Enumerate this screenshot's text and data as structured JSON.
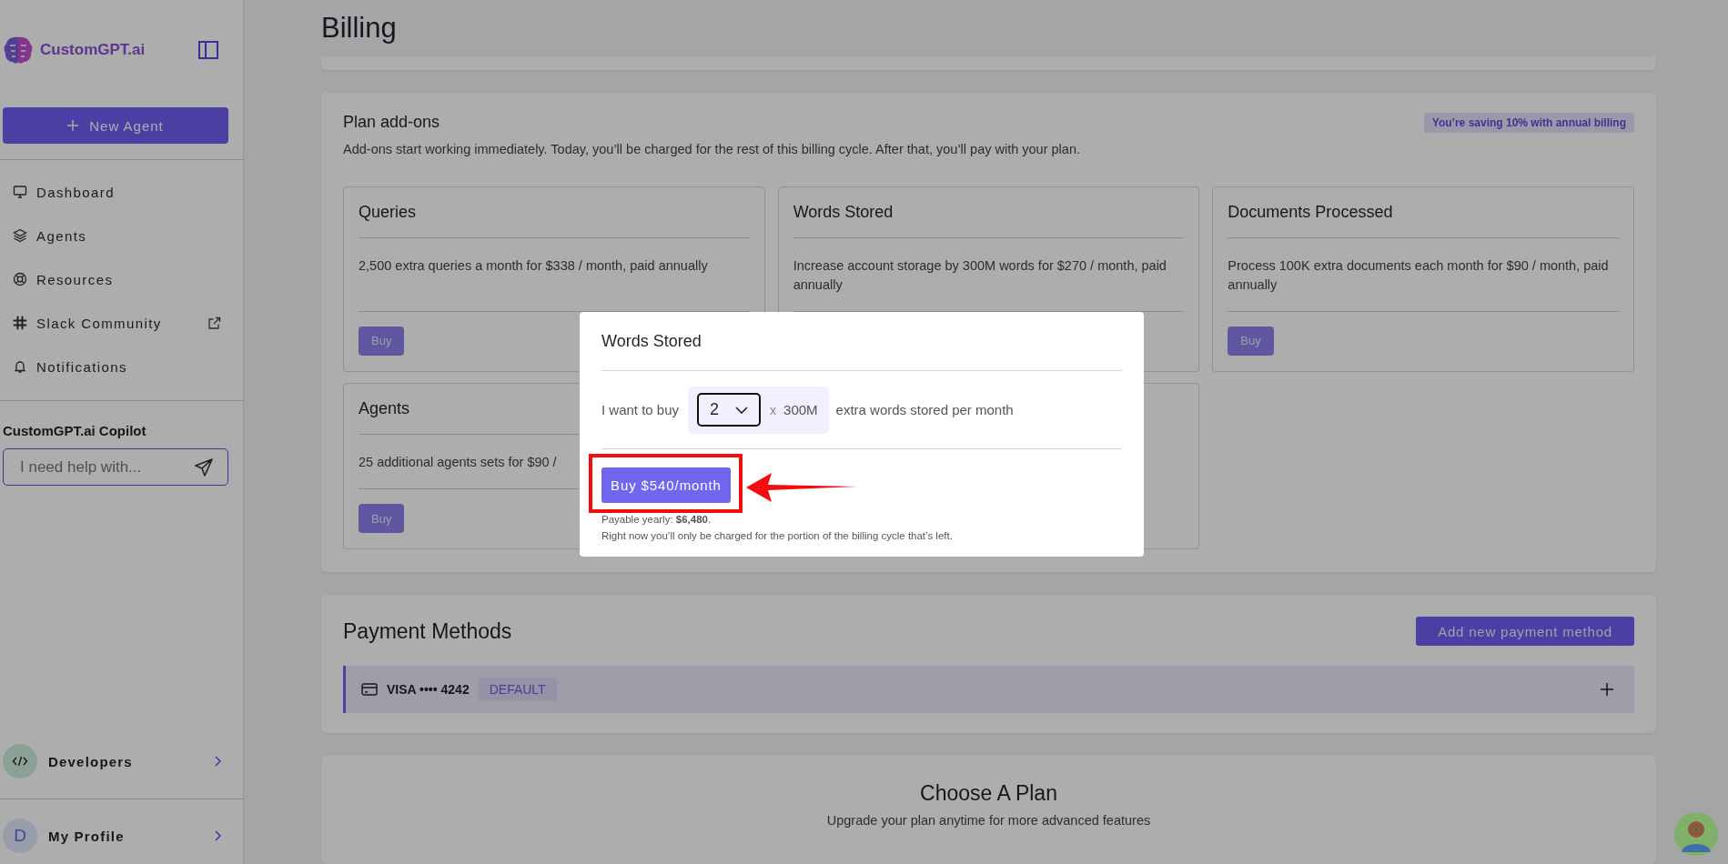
{
  "sidebar": {
    "logo_text": "CustomGPT.ai",
    "new_agent_button": "New Agent",
    "nav_items": [
      {
        "label": "Dashboard",
        "external": false
      },
      {
        "label": "Agents",
        "external": false
      },
      {
        "label": "Resources",
        "external": false
      },
      {
        "label": "Slack Community",
        "external": true
      },
      {
        "label": "Notifications",
        "external": false
      }
    ],
    "copilot": {
      "title": "CustomGPT.ai Copilot",
      "placeholder": "I need help with..."
    },
    "developers": {
      "label": "Developers"
    },
    "profile": {
      "label": "My Profile",
      "initial": "D"
    }
  },
  "page": {
    "title": "Billing"
  },
  "addons": {
    "title": "Plan add-ons",
    "description": "Add-ons start working immediately. Today, you’ll be charged for the rest of this billing cycle. After that, you’ll pay with your plan.",
    "badge": "You’re saving 10% with annual billing",
    "cards": [
      {
        "title": "Queries",
        "description": "2,500 extra queries a month for $338 / month, paid annually",
        "button": "Buy"
      },
      {
        "title": "Words Stored",
        "description": "Increase account storage by 300M words for $270 / month, paid annually"
      },
      {
        "title": "Documents Processed",
        "description": "Process 100K extra documents each month for $90 / month, paid annually",
        "button": "Buy"
      },
      {
        "title": "Agents",
        "description": "25 additional agents sets for $90 /",
        "button": "Buy"
      }
    ]
  },
  "modal": {
    "title": "Words Stored",
    "prefix": "I want to buy",
    "quantity": "2",
    "multiplier": "x",
    "unit": "300M",
    "suffix": "extra words stored per month",
    "buy_button": "Buy $540/month",
    "payable": "Payable yearly: **$6,480**.",
    "note": "Right now you’ll only be charged for the portion of the billing cycle that’s left."
  },
  "payment": {
    "title": "Payment Methods",
    "add_button": "Add new payment method",
    "methods": [
      {
        "label": "VISA •••• 4242",
        "badge": "DEFAULT"
      }
    ]
  },
  "plan": {
    "title": "Choose A Plan",
    "subtitle": "Upgrade your plan anytime for more advanced features"
  }
}
